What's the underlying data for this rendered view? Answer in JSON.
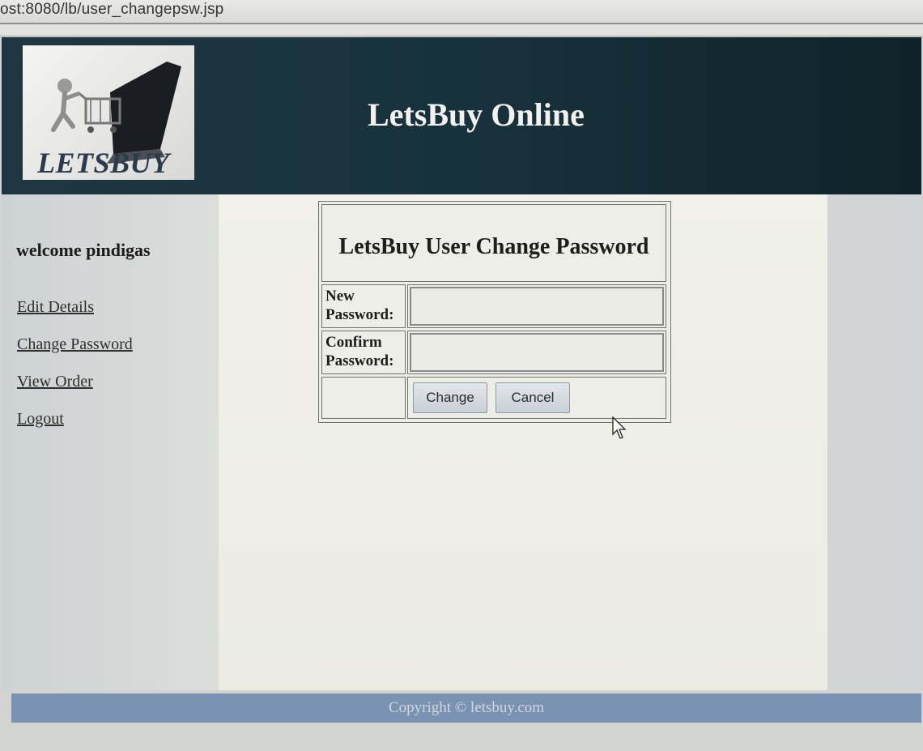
{
  "browser": {
    "url": "ost:8080/lb/user_changepsw.jsp"
  },
  "header": {
    "logo_text": "LETSBUY",
    "site_title": "LetsBuy Online"
  },
  "sidebar": {
    "welcome": "welcome pindigas",
    "links": [
      {
        "label": "Edit Details"
      },
      {
        "label": "Change Password"
      },
      {
        "label": "View Order"
      },
      {
        "label": "Logout"
      }
    ]
  },
  "form": {
    "title": "LetsBuy User Change Password",
    "new_password_label_line1": "New",
    "new_password_label_line2": "Password:",
    "new_password_value": "",
    "confirm_password_label_line1": "Confirm",
    "confirm_password_label_line2": "Password:",
    "confirm_password_value": "",
    "change_button": "Change",
    "cancel_button": "Cancel"
  },
  "footer": {
    "copyright": "Copyright © letsbuy.com"
  },
  "colors": {
    "header_bg": "#18323c",
    "footer_bg": "#7b93b2",
    "main_bg": "#f1f1ea"
  }
}
